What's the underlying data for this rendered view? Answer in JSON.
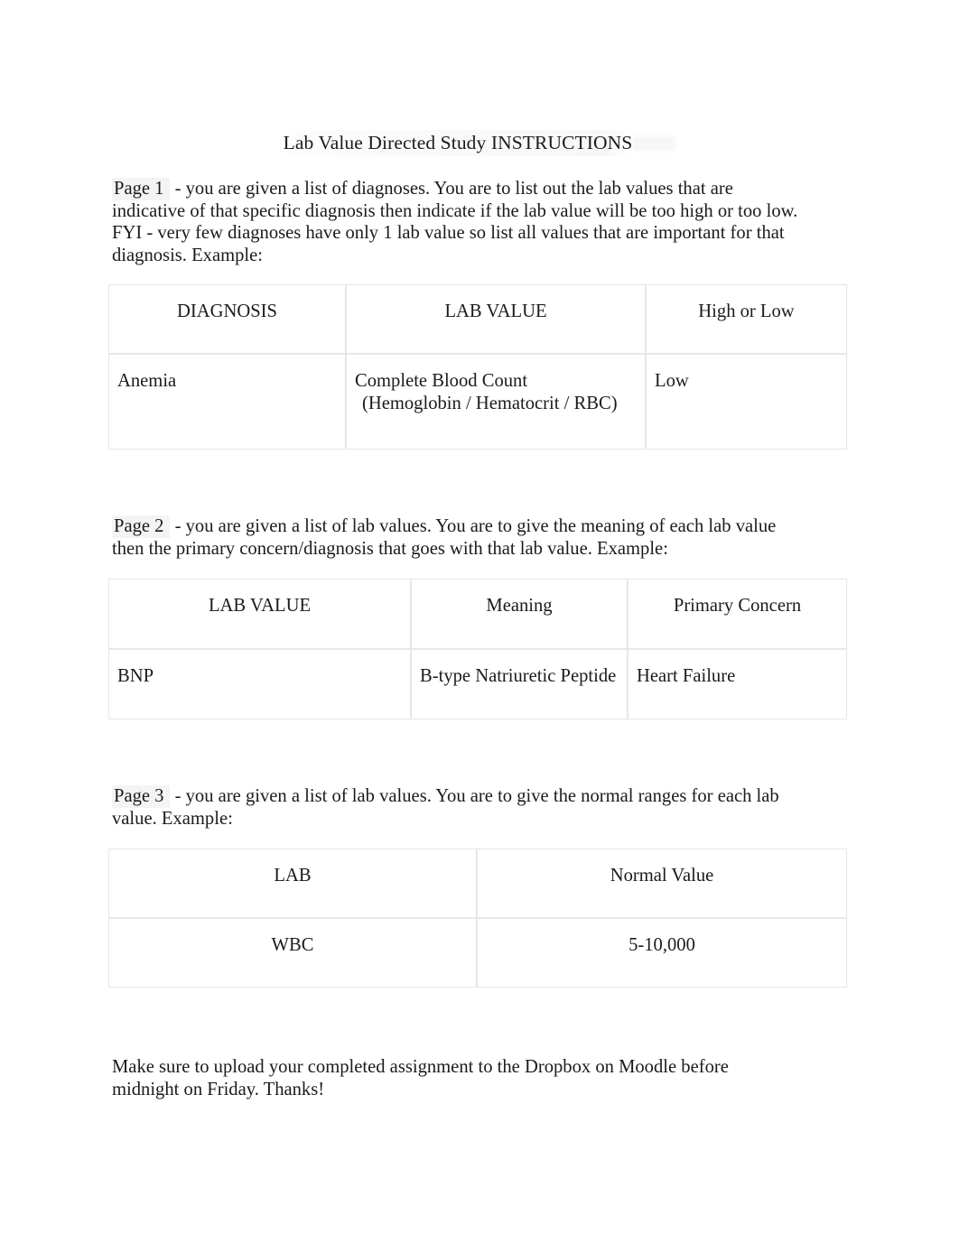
{
  "document": {
    "title": "Lab Value Directed Study INSTRUCTIONS"
  },
  "sections": {
    "page1": {
      "label": "Page 1",
      "body": " - you are given a list of diagnoses. You are to list out the lab values that are indicative of that specific diagnosis then indicate if the lab value will be too high or too low. FYI - very few diagnoses have only 1 lab value so list all values that are important for that diagnosis. Example:"
    },
    "page2": {
      "label": "Page 2",
      "body": " - you are given a list of lab values. You are to give the meaning of each lab value then the primary concern/diagnosis that goes with that lab value. Example:"
    },
    "page3": {
      "label": "Page 3",
      "body": " - you are given a list of lab values. You are to give the normal ranges for each lab value. Example:"
    }
  },
  "table1": {
    "headers": [
      "DIAGNOSIS",
      "LAB VALUE",
      "High or Low"
    ],
    "rows": [
      {
        "diagnosis": "Anemia",
        "lab_value_line1": "Complete Blood Count",
        "lab_value_line2": "(Hemoglobin / Hematocrit / RBC)",
        "high_or_low": "Low"
      }
    ]
  },
  "table2": {
    "headers": [
      "LAB VALUE",
      "Meaning",
      "Primary Concern"
    ],
    "rows": [
      {
        "lab_value": "BNP",
        "meaning": "B-type Natriuretic Peptide",
        "primary_concern": "Heart Failure"
      }
    ]
  },
  "table3": {
    "headers": [
      "LAB",
      "Normal Value"
    ],
    "rows": [
      {
        "lab": "WBC",
        "normal_value": "5-10,000"
      }
    ]
  },
  "closing": {
    "text": "Make sure to upload your completed assignment to the Dropbox on Moodle before midnight on Friday. Thanks!"
  },
  "colors": {
    "text": "#1b1b1b",
    "page_background": "#ffffff",
    "table_border": "#e9e9e9",
    "field_shade": "rgba(0,0,0,0.045)"
  }
}
